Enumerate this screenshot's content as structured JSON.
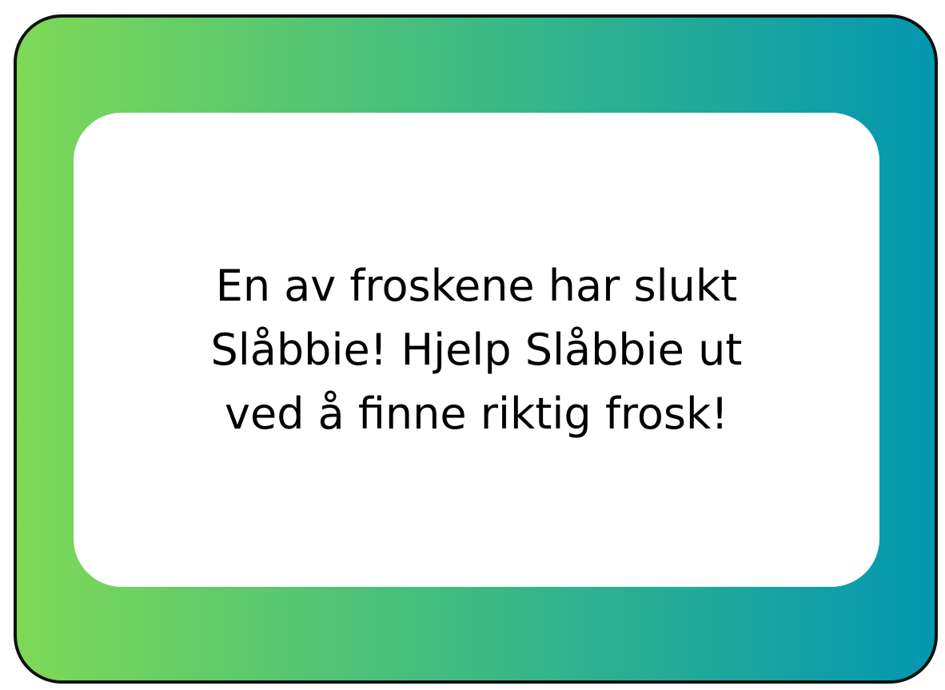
{
  "card": {
    "gradient_start": "#7ed957",
    "gradient_end": "#0397b0",
    "border_color": "#111111"
  },
  "message": {
    "lines": [
      "En av froskene har slukt",
      "Slåbbie! Hjelp Slåbbie ut",
      "ved å finne riktig frosk!"
    ]
  }
}
